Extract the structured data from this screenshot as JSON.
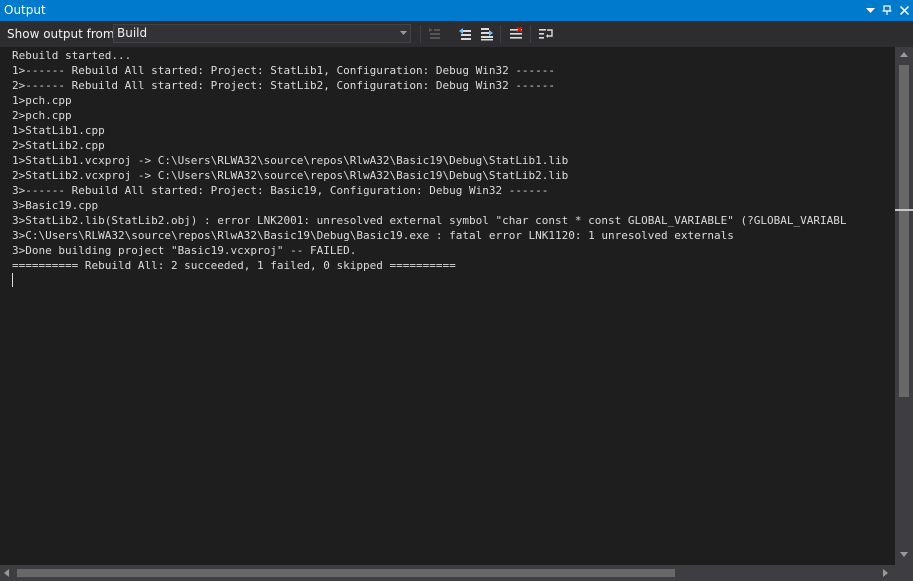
{
  "window": {
    "title": "Output",
    "accent_color": "#007acc"
  },
  "toolbar": {
    "show_output_label": "Show output from:",
    "source_selected": "Build",
    "icons": [
      "find-message-icon",
      "go-to-previous-message-icon",
      "go-to-next-message-icon",
      "clear-all-icon",
      "toggle-word-wrap-icon"
    ]
  },
  "output": {
    "lines": [
      "Rebuild started...",
      "1>------ Rebuild All started: Project: StatLib1, Configuration: Debug Win32 ------",
      "2>------ Rebuild All started: Project: StatLib2, Configuration: Debug Win32 ------",
      "1>pch.cpp",
      "2>pch.cpp",
      "1>StatLib1.cpp",
      "2>StatLib2.cpp",
      "1>StatLib1.vcxproj -> C:\\Users\\RLWA32\\source\\repos\\RlwA32\\Basic19\\Debug\\StatLib1.lib",
      "2>StatLib2.vcxproj -> C:\\Users\\RLWA32\\source\\repos\\RlwA32\\Basic19\\Debug\\StatLib2.lib",
      "3>------ Rebuild All started: Project: Basic19, Configuration: Debug Win32 ------",
      "3>Basic19.cpp",
      "3>StatLib2.lib(StatLib2.obj) : error LNK2001: unresolved external symbol \"char const * const GLOBAL_VARIABLE\" (?GLOBAL_VARIABL",
      "3>C:\\Users\\RLWA32\\source\\repos\\RlwA32\\Basic19\\Debug\\Basic19.exe : fatal error LNK1120: 1 unresolved externals",
      "3>Done building project \"Basic19.vcxproj\" -- FAILED.",
      "========== Rebuild All: 2 succeeded, 1 failed, 0 skipped =========="
    ]
  }
}
